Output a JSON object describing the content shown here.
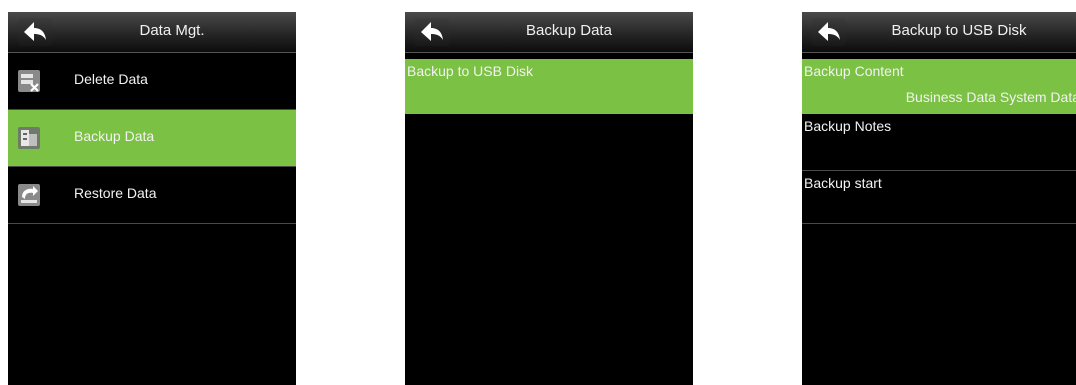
{
  "screens": [
    {
      "title": "Data Mgt.",
      "items": [
        {
          "label": "Delete Data",
          "icon": "delete-data-icon"
        },
        {
          "label": "Backup Data",
          "icon": "backup-data-icon",
          "selected": true
        },
        {
          "label": "Restore Data",
          "icon": "restore-data-icon"
        }
      ]
    },
    {
      "title": "Backup Data",
      "items": [
        {
          "label": "Backup to USB Disk",
          "selected": true
        }
      ]
    },
    {
      "title": "Backup to USB Disk",
      "items": [
        {
          "label": "Backup Content",
          "value": "Business Data System Data",
          "selected": true
        },
        {
          "label": "Backup Notes"
        },
        {
          "label": "Backup start"
        }
      ]
    }
  ],
  "colors": {
    "highlight": "#7bc143",
    "background": "#000000",
    "text": "#f2f2f2"
  },
  "icons": {
    "back": "back-arrow-icon"
  }
}
